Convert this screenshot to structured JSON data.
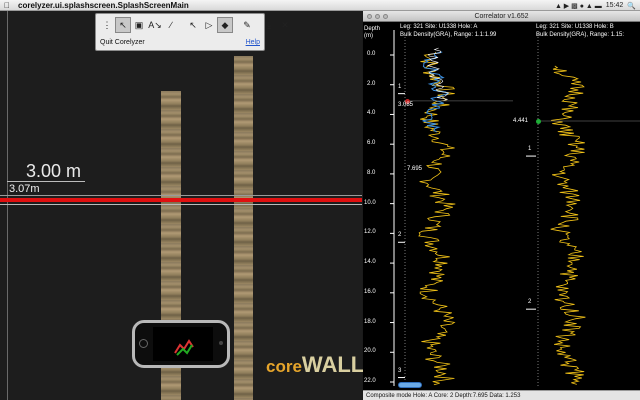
{
  "menubar": {
    "app_name": "corelyzer.ui.splashscreen.SplashScreenMain",
    "time": "15:42"
  },
  "palette": {
    "quit_label": "Quit Corelyzer",
    "help_label": "Help"
  },
  "corelyzer": {
    "depth_big": "3.00 m",
    "depth_small": "3.07m"
  },
  "correlator": {
    "title": "Correlator v1.652",
    "left_header_line1": "Leg: 321 Site: U1338 Hole: A",
    "left_header_line2": "Bulk Density(GRA), Range: 1.1:1.99",
    "right_header_line1": "Leg: 321 Site: U1338 Hole: B",
    "right_header_line2": "Bulk Density(GRA), Range: 1.15:",
    "depth_axis_title": "Depth\n(m)",
    "depth_ticks": [
      "0.0",
      "2.0",
      "4.0",
      "6.0",
      "8.0",
      "10.0",
      "12.0",
      "14.0",
      "16.0",
      "18.0",
      "20.0",
      "22.0"
    ],
    "left_core_numbers": [
      "1",
      "2",
      "3"
    ],
    "right_core_numbers": [
      "1",
      "2"
    ],
    "marker_left": "3.085",
    "marker_middle": "7.695",
    "marker_right": "4.441",
    "status": "Composite mode  Hole: A Core: 2 Depth:7.695 Data: 1.253"
  },
  "colors": {
    "accent_red": "#e01010",
    "log_yellow": "#f5c518",
    "log_blue": "#3b8fe0",
    "marker_green": "#1fae38"
  }
}
